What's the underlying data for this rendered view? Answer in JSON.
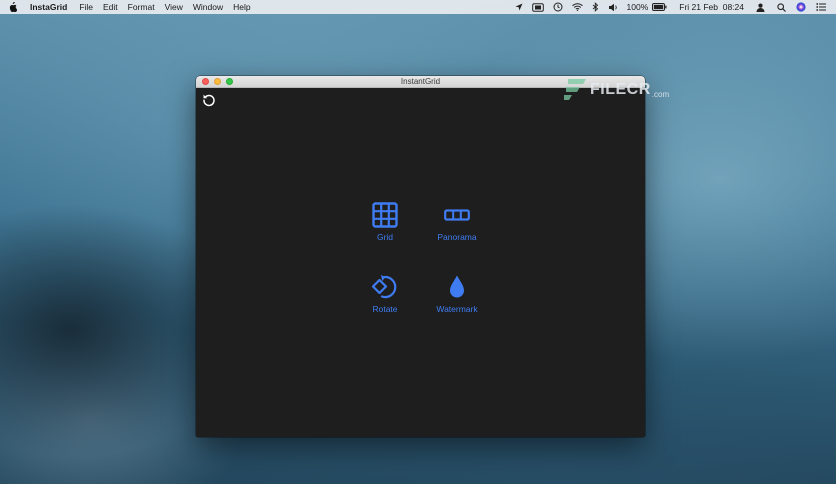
{
  "menubar": {
    "app_name": "InstaGrid",
    "menus": [
      "File",
      "Edit",
      "Format",
      "View",
      "Window",
      "Help"
    ],
    "battery": "100%",
    "datetime": "Fri 21 Feb  08:24"
  },
  "window": {
    "title": "InstantGrid"
  },
  "overlay": {
    "logo_text": "FILECR",
    "logo_suffix": ".com"
  },
  "tools": {
    "grid": "Grid",
    "panorama": "Panorama",
    "rotate": "Rotate",
    "watermark": "Watermark"
  },
  "colors": {
    "accent": "#3f7cf2",
    "window_bg": "#1e1e1e"
  }
}
